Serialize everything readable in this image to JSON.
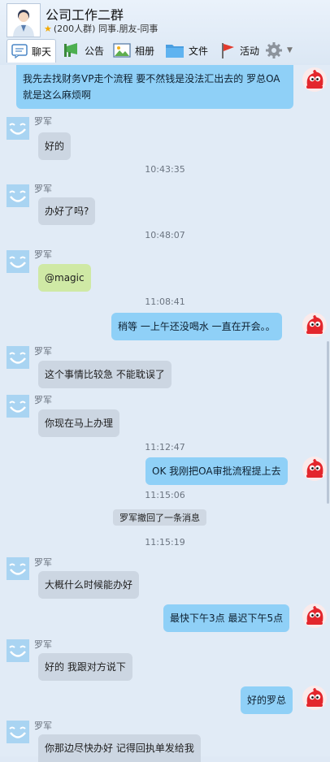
{
  "window": {
    "title": "公司工作二群",
    "subtitle": "(200人群) 同事.朋友-同事"
  },
  "toolbar": {
    "tabs": [
      "聊天",
      "公告",
      "相册",
      "文件",
      "活动"
    ]
  },
  "messages": {
    "m0": "我先去找财务VP走个流程 要不然钱是没法汇出去的 罗总OA就是这么麻烦啊",
    "m1_name": "罗军",
    "m1": "好的",
    "t1": "10:43:35",
    "m2_name": "罗军",
    "m2": "办好了吗?",
    "t2": "10:48:07",
    "m3_name": "罗军",
    "m3": "@magic",
    "t3": "11:08:41",
    "m4": "稍等 一上午还没喝水 一直在开会。。",
    "m5_name": "罗军",
    "m5": "这个事情比较急 不能耽误了",
    "m6_name": "罗军",
    "m6": "你现在马上办理",
    "t4": "11:12:47",
    "m7": "OK 我刚把OA审批流程提上去",
    "t5": "11:15:06",
    "notice": "罗军撤回了一条消息",
    "t6": "11:15:19",
    "m8_name": "罗军",
    "m8": "大概什么时候能办好",
    "m9": "最快下午3点 最迟下午5点",
    "m10_name": "罗军",
    "m10": "好的 我跟对方说下",
    "m11": "好的罗总",
    "m12_name": "罗军",
    "m12": "你那边尽快办好 记得回执单发给我"
  },
  "colors": {
    "incoming_bubble": "#ccd6e2",
    "outgoing_bubble": "#8fd0f7",
    "mention_bubble": "#cfe9a5",
    "chat_background": "#e1ebf6"
  }
}
